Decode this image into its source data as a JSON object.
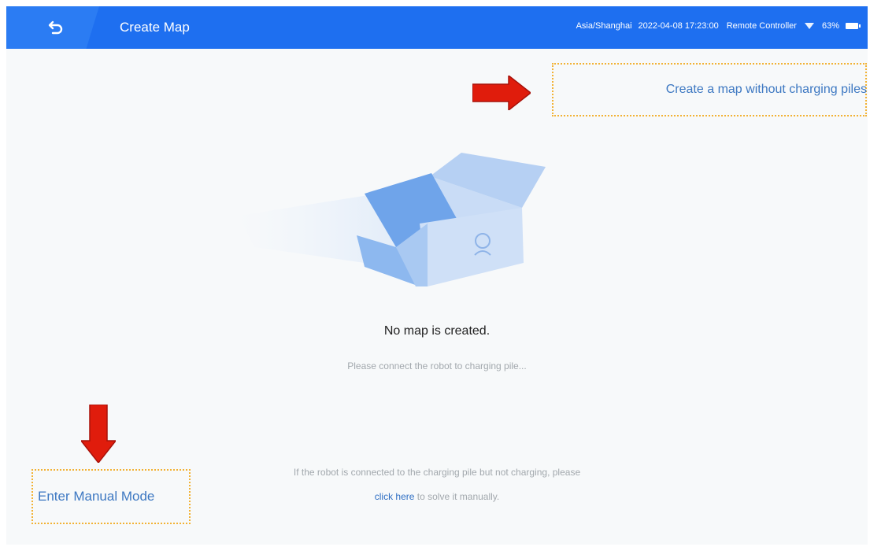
{
  "header": {
    "title": "Create Map",
    "timezone": "Asia/Shanghai",
    "datetime": "2022-04-08 17:23:00",
    "controller": "Remote Controller",
    "battery": "63%"
  },
  "actions": {
    "create_without_pile": "Create a map without charging piles",
    "manual_mode": "Enter Manual Mode"
  },
  "empty_state": {
    "title": "No map is created.",
    "subtitle": "Please connect the robot to charging pile..."
  },
  "help": {
    "line1": "If the robot is connected to the charging pile but not charging, please",
    "link": "click here",
    "line2_rest": " to solve it manually."
  },
  "colors": {
    "topbar": "#1e6ff0",
    "accent": "#3d78c2",
    "highlight": "#f2b234",
    "arrow": "#e01c0c"
  },
  "icons": {
    "back": "back-icon",
    "wifi": "wifi-icon",
    "battery": "battery-icon",
    "illustration": "empty-box-illustration"
  }
}
